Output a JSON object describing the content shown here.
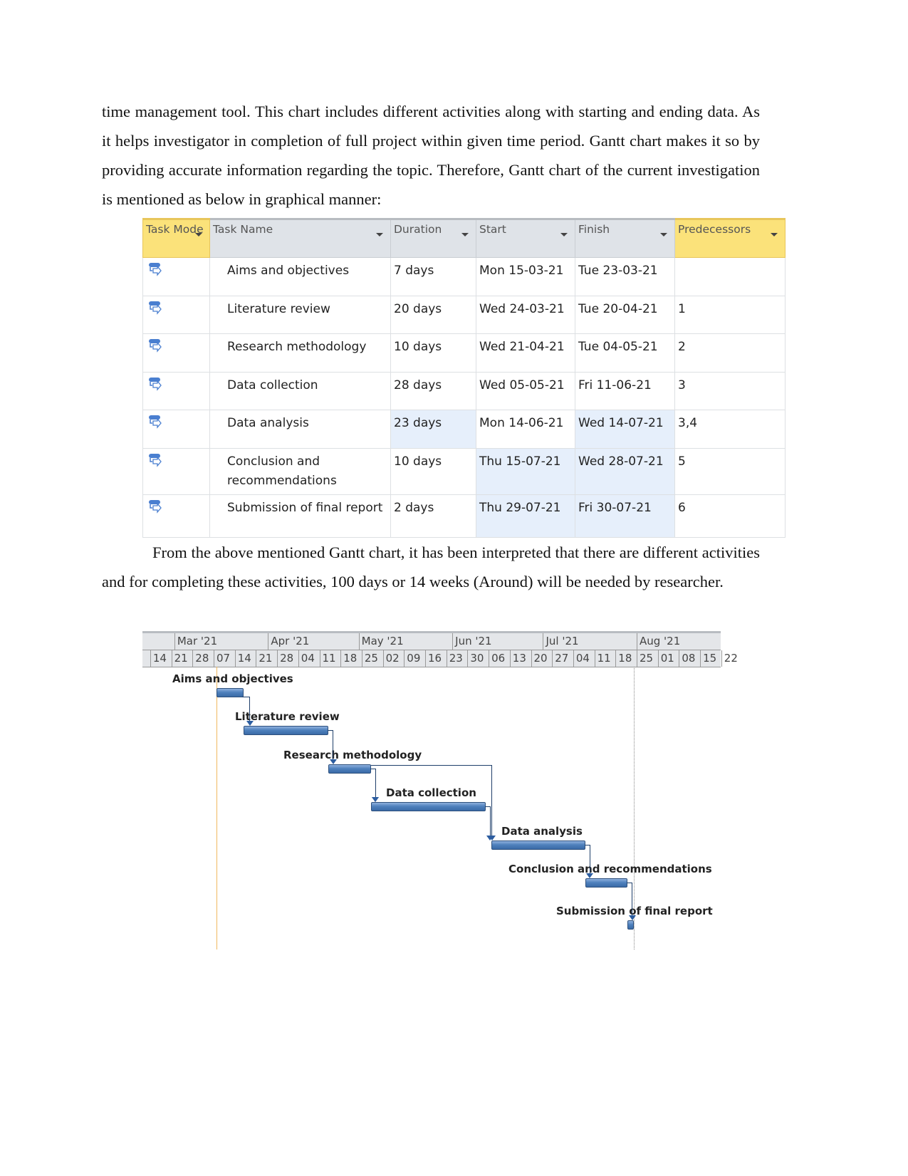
{
  "paragraphs": [
    "time management tool. This chart includes different activities along with starting and ending data. As it helps investigator in completion of full project within given time period. Gantt chart makes it so by providing accurate information regarding the topic. Therefore, Gantt chart of the current investigation is mentioned as below in graphical manner:",
    "From the above mentioned Gantt chart, it has been interpreted that there are different activities and for completing these activities, 100 days or 14 weeks (Around) will be needed by researcher."
  ],
  "table": {
    "headers": [
      "Task Mode",
      "Task Name",
      "Duration",
      "Start",
      "Finish",
      "Predecessors"
    ],
    "task_mode_icon": "auto-scheduled-task-icon",
    "rows": [
      {
        "name": "Aims and objectives",
        "duration": "7 days",
        "start": "Mon 15-03-21",
        "finish": "Tue 23-03-21",
        "pred": ""
      },
      {
        "name": "Literature review",
        "duration": "20 days",
        "start": "Wed 24-03-21",
        "finish": "Tue 20-04-21",
        "pred": "1"
      },
      {
        "name": "Research methodology",
        "duration": "10 days",
        "start": "Wed 21-04-21",
        "finish": "Tue 04-05-21",
        "pred": "2"
      },
      {
        "name": "Data collection",
        "duration": "28 days",
        "start": "Wed 05-05-21",
        "finish": "Fri 11-06-21",
        "pred": "3"
      },
      {
        "name": "Data analysis",
        "duration": "23 days",
        "start": "Mon 14-06-21",
        "finish": "Wed 14-07-21",
        "pred": "3,4"
      },
      {
        "name": "Conclusion and recommendations",
        "duration": "10 days",
        "start": "Thu 15-07-21",
        "finish": "Wed 28-07-21",
        "pred": "5"
      },
      {
        "name": "Submission of final report",
        "duration": "2 days",
        "start": "Thu 29-07-21",
        "finish": "Fri 30-07-21",
        "pred": "6"
      }
    ]
  },
  "gantt": {
    "months": [
      "Mar '21",
      "Apr '21",
      "May '21",
      "Jun '21",
      "Jul '21",
      "Aug '21"
    ],
    "weeks": [
      "14",
      "21",
      "28",
      "07",
      "14",
      "21",
      "28",
      "04",
      "11",
      "18",
      "25",
      "02",
      "09",
      "16",
      "23",
      "30",
      "06",
      "13",
      "20",
      "27",
      "04",
      "11",
      "18",
      "25",
      "01",
      "08",
      "15",
      "22"
    ],
    "bar_color": "#4f81bd",
    "start_line_color": "#f0b860",
    "tasks": [
      {
        "label": "Aims and objectives",
        "start": "2021-03-15",
        "finish": "2021-03-23"
      },
      {
        "label": "Literature review",
        "start": "2021-03-24",
        "finish": "2021-04-20"
      },
      {
        "label": "Research methodology",
        "start": "2021-04-21",
        "finish": "2021-05-04"
      },
      {
        "label": "Data collection",
        "start": "2021-05-05",
        "finish": "2021-06-11"
      },
      {
        "label": "Data analysis",
        "start": "2021-06-14",
        "finish": "2021-07-14"
      },
      {
        "label": "Conclusion and recommendations",
        "start": "2021-07-15",
        "finish": "2021-07-28"
      },
      {
        "label": "Submission of final report",
        "start": "2021-07-29",
        "finish": "2021-07-30"
      }
    ]
  }
}
